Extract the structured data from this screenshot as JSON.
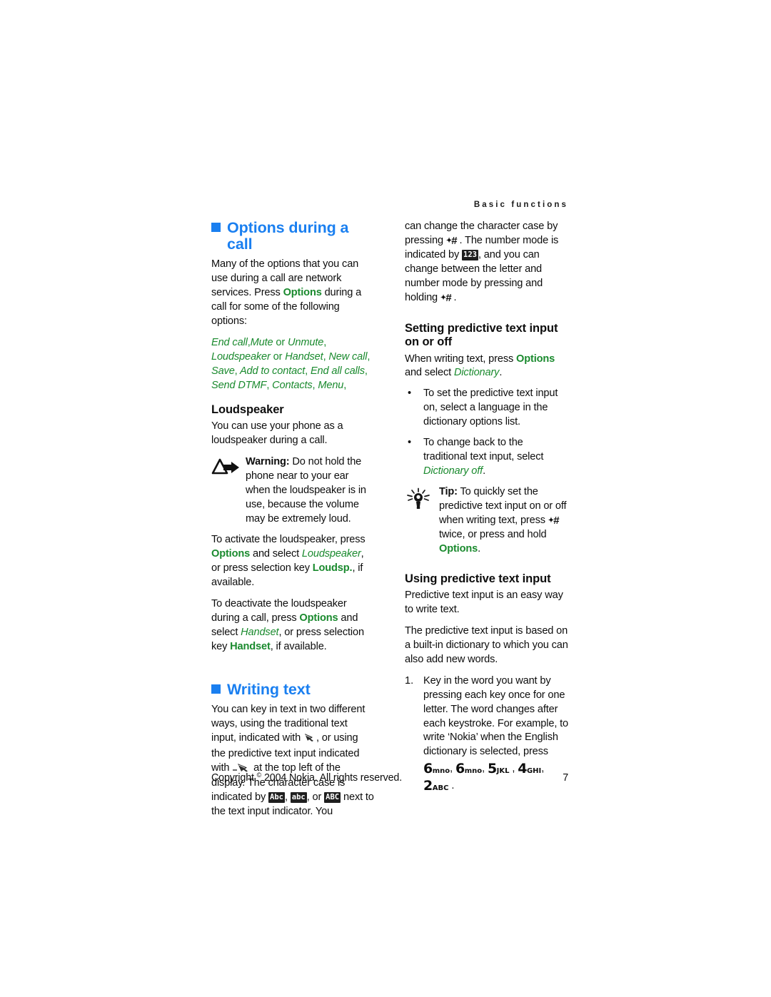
{
  "header": {
    "running_head": "Basic functions"
  },
  "footer": {
    "copyright_pre": "Copyright",
    "copyright_symbol": "©",
    "copyright_post": " 2004 Nokia. All rights reserved.",
    "page_number": "7"
  },
  "colors": {
    "heading_blue": "#1a7ff0",
    "accent_green": "#1a8a2e",
    "body_text": "#0d0d0d"
  },
  "left_column": {
    "section1": {
      "heading": "Options during a call",
      "para1_a": "Many of the options that you can use during a call are network services. Press ",
      "para1_options": "Options",
      "para1_b": " during a call for some of the following options:",
      "options_list": [
        {
          "label": "End call",
          "sep": ","
        },
        {
          "label": "Mute",
          "sep": " or "
        },
        {
          "label": "Unmute",
          "sep": ","
        },
        {
          "label": "Loudspeaker",
          "sep": " or "
        },
        {
          "label": "Handset",
          "sep": ","
        },
        {
          "label": "New call",
          "sep": ","
        },
        {
          "label": "Save",
          "sep": ","
        },
        {
          "label": "Add to contact",
          "sep": ","
        },
        {
          "label": "End all calls",
          "sep": ","
        },
        {
          "label": "Send DTMF",
          "sep": ","
        },
        {
          "label": "Contacts",
          "sep": ","
        },
        {
          "label": "Menu",
          "sep": ","
        }
      ]
    },
    "loudspeaker": {
      "heading": "Loudspeaker",
      "para1": "You can use your phone as a loudspeaker during a call.",
      "warning_label": "Warning:",
      "warning_text": " Do not hold the phone near to your ear when the loudspeaker is in use, because the volume may be extremely loud.",
      "activate_a": "To activate the loudspeaker, press ",
      "activate_options": "Options",
      "activate_b": " and select ",
      "activate_loudspeaker": "Loudspeaker",
      "activate_c": ", or press selection key ",
      "activate_loudsp": "Loudsp.",
      "activate_d": ", if available.",
      "deactivate_a": "To deactivate the loudspeaker during a call, press ",
      "deactivate_options": "Options",
      "deactivate_b": " and select ",
      "deactivate_handset_i": "Handset",
      "deactivate_c": ", or press selection key ",
      "deactivate_handset_b": "Handset",
      "deactivate_d": ", if available."
    },
    "writing_text": {
      "heading": "Writing text",
      "para_a": "You can key in text in two different ways, using the traditional text input, indicated with ",
      "glyph_traditional": "traditional-text-input-icon",
      "para_b": ", or using the predictive text input indicated with ",
      "glyph_predictive": "predictive-text-input-icon",
      "para_c": " at the top left of the display. The character case is indicated by ",
      "case_indicator_1": "Abc",
      "case_sep_1": ", ",
      "case_indicator_2": "abc",
      "case_sep_2": ", or ",
      "case_indicator_3": "ABC",
      "para_d": " next to the text input indicator. You"
    }
  },
  "right_column": {
    "continuation": {
      "text_a": "can change the character case by pressing ",
      "hash_key": "#",
      "text_b": " . The number mode is indicated by ",
      "num_indicator": "123",
      "text_c": ", and you can change between the letter and number mode by pressing and holding ",
      "text_d": " ."
    },
    "setting_predictive": {
      "heading": "Setting predictive text input on or off",
      "para_a": "When writing text, press ",
      "para_options": "Options",
      "para_b": " and select ",
      "para_dictionary": "Dictionary",
      "para_c": ".",
      "bullets": [
        {
          "mark": "•",
          "text_a": "To set the predictive text input on, select a language in the dictionary options list.",
          "emph": "",
          "text_b": ""
        },
        {
          "mark": "•",
          "text_a": "To change back to the traditional text input, select ",
          "emph": "Dictionary off",
          "text_b": "."
        }
      ],
      "tip_label": "Tip:",
      "tip_text_a": " To quickly set the predictive text input on or off when writing text, press ",
      "tip_text_b": " twice, or press and hold ",
      "tip_options": "Options",
      "tip_text_c": "."
    },
    "using_predictive": {
      "heading": "Using predictive text input",
      "para1": "Predictive text input is an easy way to write text.",
      "para2": "The predictive text input is based on a built-in dictionary to which you can also add new words.",
      "step_number": "1.",
      "step_text": "Key in the word you want by pressing each key once for one letter. The word changes after each keystroke. For example, to write ‘Nokia’ when the English dictionary is selected, press ",
      "keys": [
        {
          "digit": "6",
          "letters": "mno",
          "sep": ", "
        },
        {
          "digit": "6",
          "letters": "mno",
          "sep": ", "
        },
        {
          "digit": "5",
          "letters": "JKL",
          "sep": " , "
        },
        {
          "digit": "4",
          "letters": "GHI",
          "sep": ", "
        },
        {
          "digit": "2",
          "letters": "ABC",
          "sep": " ."
        }
      ]
    }
  }
}
